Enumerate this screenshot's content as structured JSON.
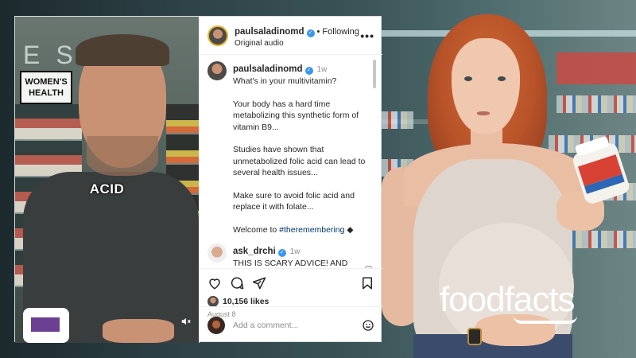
{
  "post": {
    "username": "paulsaladinomd",
    "follow_label": "Following",
    "audio_label": "Original audio",
    "more_label": "•••",
    "time": "1w",
    "caption_lines": [
      "What's in your multivitamin?",
      "Your body has a hard time metabolizing this synthetic form of vitamin B9...",
      "Studies have shown that unmetabolized folic acid can lead to several health issues...",
      "Make sure to avoid folic acid and replace it with folate...",
      "Welcome to"
    ],
    "hashtag": "#theremembering",
    "caption_end_glyph": "◆",
    "video_caption": "ACID",
    "store_sign": "WOMEN'S HEALTH"
  },
  "comment": {
    "username": "ask_drchi",
    "time": "1w",
    "text": "THIS IS SCARY ADVICE! AND NOT OKAY! Folic Acid is necessary. Period."
  },
  "stats": {
    "likes": "10,156 likes",
    "date": "August 8"
  },
  "composer": {
    "placeholder": "Add a comment..."
  },
  "watermark": {
    "brand": "foodfacts"
  },
  "icons": [
    "heart-icon",
    "comment-icon",
    "share-icon",
    "bookmark-icon",
    "verified-icon",
    "emoji-icon",
    "mute-icon",
    "more-icon"
  ]
}
